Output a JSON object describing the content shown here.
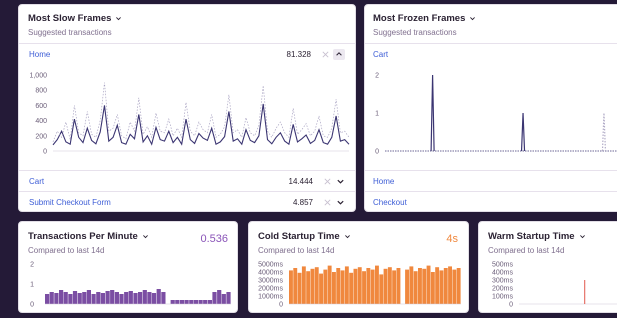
{
  "colors": {
    "background": "#241a37",
    "link": "#3e5ed6",
    "slow_frames_series": "#3b3572",
    "frozen_series": "#3b3572",
    "tpm_series": "#7b4ea3",
    "cold_startup_series": "#f0883e",
    "warm_startup_series": "#e2574c",
    "tpm_value": "#8a54b8",
    "cold_value": "#f0883e"
  },
  "slow_frames": {
    "title": "Most Slow Frames",
    "subtitle": "Suggested transactions",
    "active_item": {
      "label": "Home",
      "value": "81.328"
    },
    "items": [
      {
        "label": "Cart",
        "value": "14.444"
      },
      {
        "label": "Submit Checkout Form",
        "value": "4.857"
      }
    ],
    "chart_data": {
      "type": "line",
      "yticks": [
        "1,000",
        "800",
        "600",
        "400",
        "200",
        "0"
      ],
      "ylim": [
        0,
        1000
      ],
      "series": [
        {
          "values": [
            80,
            150,
            260,
            120,
            90,
            420,
            180,
            110,
            300,
            140,
            95,
            250,
            600,
            130,
            180,
            340,
            110,
            90,
            220,
            160,
            480,
            120,
            200,
            90,
            310,
            150,
            130,
            260,
            110,
            180,
            90,
            420,
            150,
            100,
            230,
            170,
            140,
            300,
            90,
            120,
            190,
            520,
            130,
            160,
            90,
            280,
            140,
            110,
            200,
            620,
            150,
            95,
            180,
            240,
            130,
            90,
            350,
            120,
            160,
            210,
            100,
            140,
            280,
            110,
            90,
            180,
            460,
            130,
            150,
            90
          ]
        },
        {
          "values": [
            120,
            260,
            180,
            380,
            150,
            600,
            240,
            200,
            520,
            220,
            180,
            400,
            900,
            260,
            300,
            480,
            200,
            160,
            380,
            260,
            700,
            220,
            320,
            180,
            500,
            260,
            240,
            420,
            200,
            300,
            180,
            640,
            260,
            200,
            380,
            280,
            240,
            480,
            180,
            220,
            320,
            740,
            240,
            280,
            180,
            440,
            240,
            200,
            340,
            860,
            260,
            180,
            300,
            380,
            240,
            180,
            560,
            220,
            280,
            360,
            200,
            260,
            460,
            200,
            180,
            300,
            680,
            240,
            260,
            180
          ]
        }
      ]
    }
  },
  "frozen_frames": {
    "title": "Most Frozen Frames",
    "subtitle": "Suggested transactions",
    "active_item": {
      "label": "Cart"
    },
    "items": [
      {
        "label": "Home"
      },
      {
        "label": "Checkout"
      }
    ],
    "chart_data": {
      "type": "line",
      "yticks": [
        "2",
        "1",
        "0"
      ],
      "ylim": [
        0,
        2
      ],
      "spikes": [
        {
          "x": 0.2,
          "y": 2,
          "series": "solid"
        },
        {
          "x": 0.58,
          "y": 1,
          "series": "solid"
        },
        {
          "x": 0.92,
          "y": 1,
          "series": "dashed"
        }
      ]
    }
  },
  "tpm": {
    "title": "Transactions Per Minute",
    "subtitle": "Compared to last 14d",
    "value": "0.536",
    "chart_data": {
      "type": "area",
      "yticks": [
        "2",
        "1",
        "0"
      ],
      "ylim": [
        0,
        2
      ],
      "values": [
        0.5,
        0.6,
        0.55,
        0.7,
        0.6,
        0.5,
        0.65,
        0.55,
        0.6,
        0.7,
        0.5,
        0.6,
        0.55,
        0.65,
        0.7,
        0.6,
        0.5,
        0.6,
        0.65,
        0.55,
        0.6,
        0.7,
        0.6,
        0.55,
        0.75,
        0.6,
        0,
        0.2,
        0.2,
        0.2,
        0.2,
        0.2,
        0.2,
        0.2,
        0.2,
        0.2,
        0.6,
        0.7,
        0.5,
        0.6
      ]
    }
  },
  "cold_startup": {
    "title": "Cold Startup Time",
    "subtitle": "Compared to last 14d",
    "value": "4s",
    "chart_data": {
      "type": "area",
      "yticks": [
        "5000ms",
        "4000ms",
        "3000ms",
        "2000ms",
        "1000ms",
        "0"
      ],
      "ylim": [
        0,
        5000
      ],
      "values": [
        4200,
        4500,
        3900,
        4700,
        4100,
        4400,
        4600,
        3800,
        4300,
        4800,
        4000,
        4500,
        4200,
        4700,
        3900,
        4400,
        4600,
        4100,
        4500,
        4300,
        4800,
        3700,
        4400,
        4600,
        4200,
        4500,
        0,
        4300,
        4700,
        4100,
        4500,
        4400,
        4800,
        4000,
        4600,
        4200,
        4500,
        4700,
        4300,
        4500
      ]
    }
  },
  "warm_startup": {
    "title": "Warm Startup Time",
    "subtitle": "Compared to last 14d",
    "chart_data": {
      "type": "line",
      "yticks": [
        "500ms",
        "400ms",
        "300ms",
        "200ms",
        "100ms",
        "0"
      ],
      "ylim": [
        0,
        500
      ],
      "spikes": [
        {
          "x": 0.62,
          "y": 300
        }
      ]
    }
  }
}
